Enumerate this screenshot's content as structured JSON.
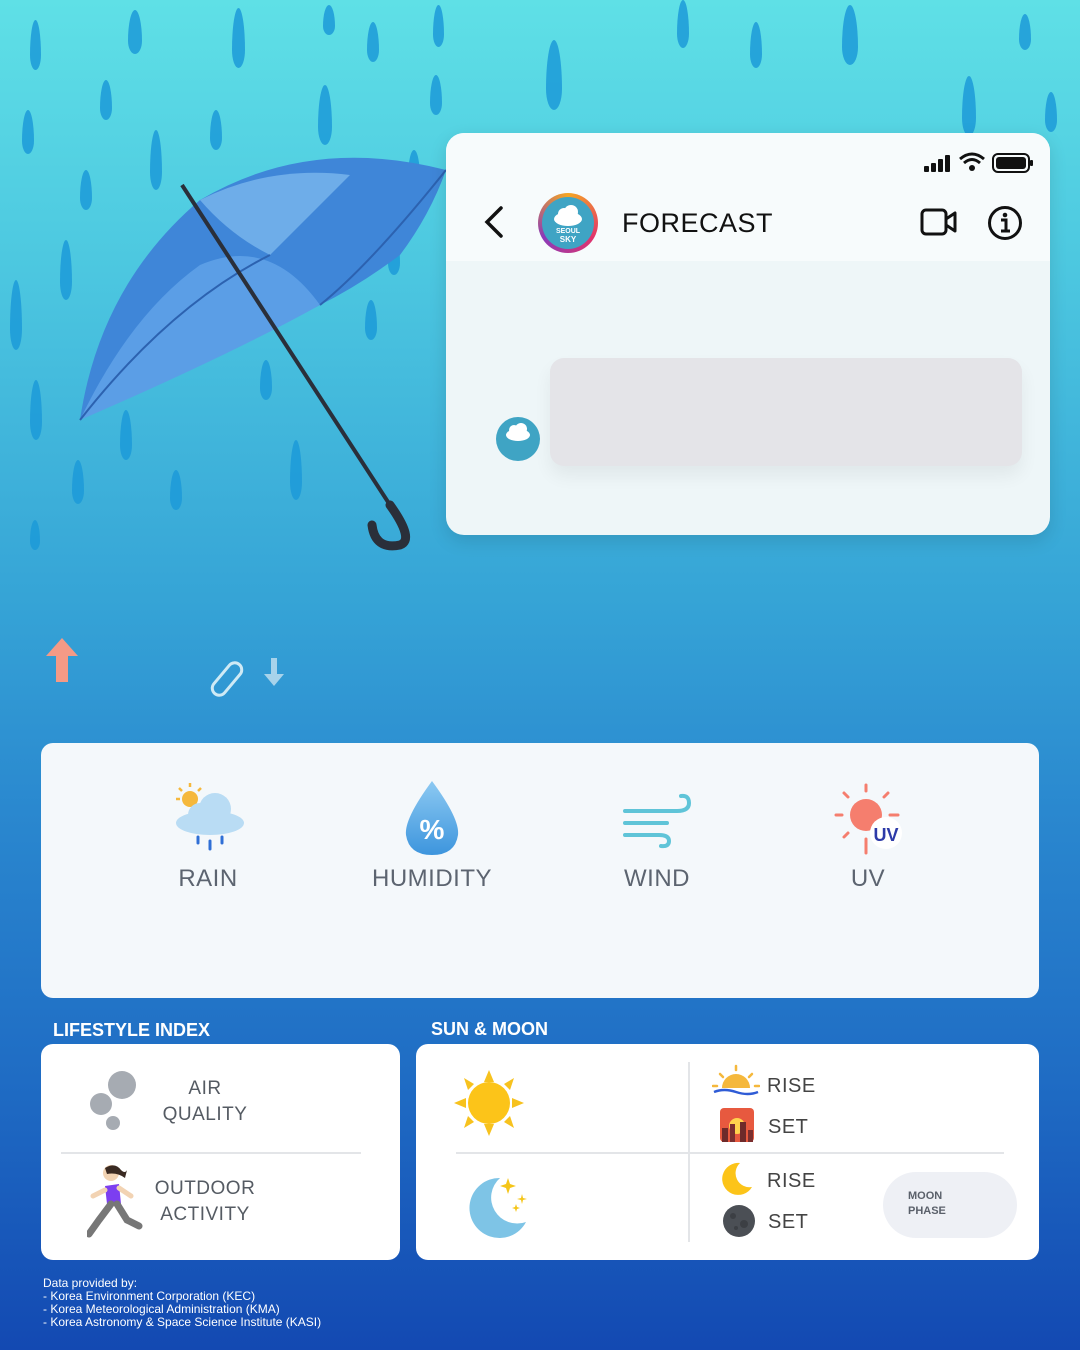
{
  "status_bar": {
    "icons": [
      "signal-icon",
      "wifi-icon",
      "battery-icon"
    ]
  },
  "chat": {
    "title": "FORECAST",
    "avatar_text": [
      "SEOUL",
      "SKY"
    ],
    "icons": [
      "back-arrow-icon",
      "video-call-icon",
      "info-icon"
    ]
  },
  "actions": {
    "icons": [
      "arrow-up-icon",
      "paperclip-icon",
      "arrow-down-icon"
    ]
  },
  "metrics": {
    "items": [
      {
        "label": "RAIN",
        "icon": "rain-cloud-icon"
      },
      {
        "label": "HUMIDITY",
        "icon": "humidity-drop-icon"
      },
      {
        "label": "WIND",
        "icon": "wind-icon"
      },
      {
        "label": "UV",
        "icon": "uv-sun-icon"
      }
    ]
  },
  "lifestyle": {
    "title": "LIFESTYLE INDEX",
    "air_quality": {
      "line1": "AIR",
      "line2": "QUALITY"
    },
    "outdoor": {
      "line1": "OUTDOOR",
      "line2": "ACTIVITY"
    }
  },
  "sunmoon": {
    "title": "SUN & MOON",
    "sun_rise": "RISE",
    "sun_set": "SET",
    "moon_rise": "RISE",
    "moon_set": "SET",
    "moon_phase": {
      "line1": "MOON",
      "line2": "PHASE"
    }
  },
  "credits": {
    "heading": "Data provided by:",
    "lines": [
      "- Korea Environment Corporation (KEC)",
      "- Korea Meteorological Administration (KMA)",
      "- Korea Astronomy & Space Science Institute (KASI)"
    ]
  },
  "colors": {
    "accent_blue": "#1f6cc4",
    "card_bg": "#f4f8fb",
    "up_arrow": "#f49a86"
  }
}
